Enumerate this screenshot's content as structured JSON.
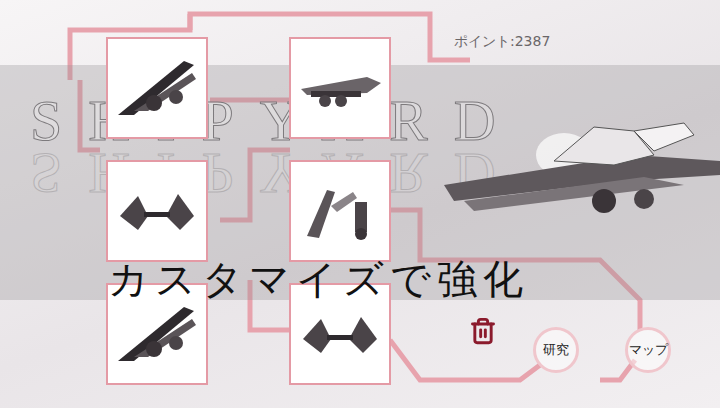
{
  "title": "SHIPYARD",
  "points": "ポイント:2387",
  "caption": "カスタマイズで強化",
  "parts": [
    {
      "kind": "wing"
    },
    {
      "kind": "cannon"
    },
    {
      "kind": "twin"
    },
    {
      "kind": "claw"
    },
    {
      "kind": "wing"
    },
    {
      "kind": "twin"
    }
  ],
  "buttons": [
    {
      "label": "研究"
    },
    {
      "label": "マップ"
    }
  ]
}
